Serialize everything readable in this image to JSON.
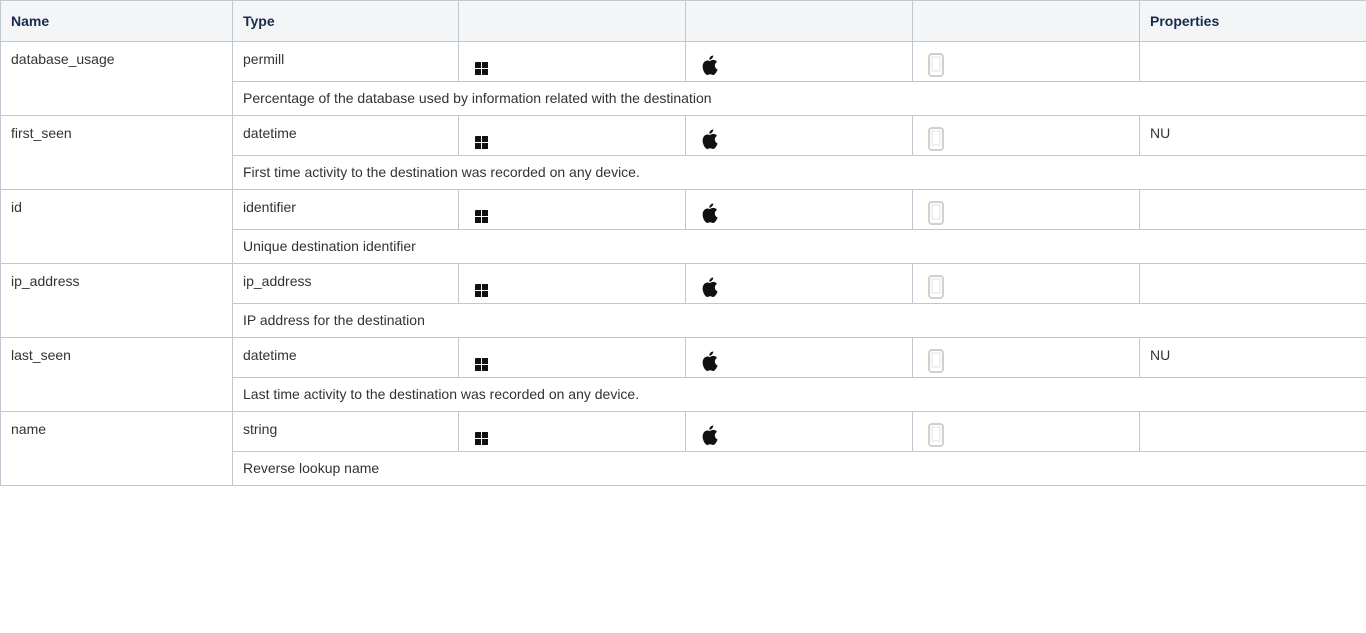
{
  "headers": {
    "name": "Name",
    "type": "Type",
    "windows": "",
    "mac": "",
    "mobile": "",
    "properties": "Properties"
  },
  "platform_icons": {
    "windows": "windows-icon",
    "mac": "apple-icon",
    "mobile": "tablet-icon",
    "mobile_color": "#d0d0d0"
  },
  "rows": [
    {
      "name": "database_usage",
      "type": "permill",
      "properties": "",
      "description": "Percentage of the database used by information related with the destination"
    },
    {
      "name": "first_seen",
      "type": "datetime",
      "properties": "NU",
      "description": "First time activity to the destination was recorded on any device."
    },
    {
      "name": "id",
      "type": "identifier",
      "properties": "",
      "description": "Unique destination identifier"
    },
    {
      "name": "ip_address",
      "type": "ip_address",
      "properties": "",
      "description": "IP address for the destination"
    },
    {
      "name": "last_seen",
      "type": "datetime",
      "properties": "NU",
      "description": "Last time activity to the destination was recorded on any device."
    },
    {
      "name": "name",
      "type": "string",
      "properties": "",
      "description": "Reverse lookup name"
    }
  ]
}
